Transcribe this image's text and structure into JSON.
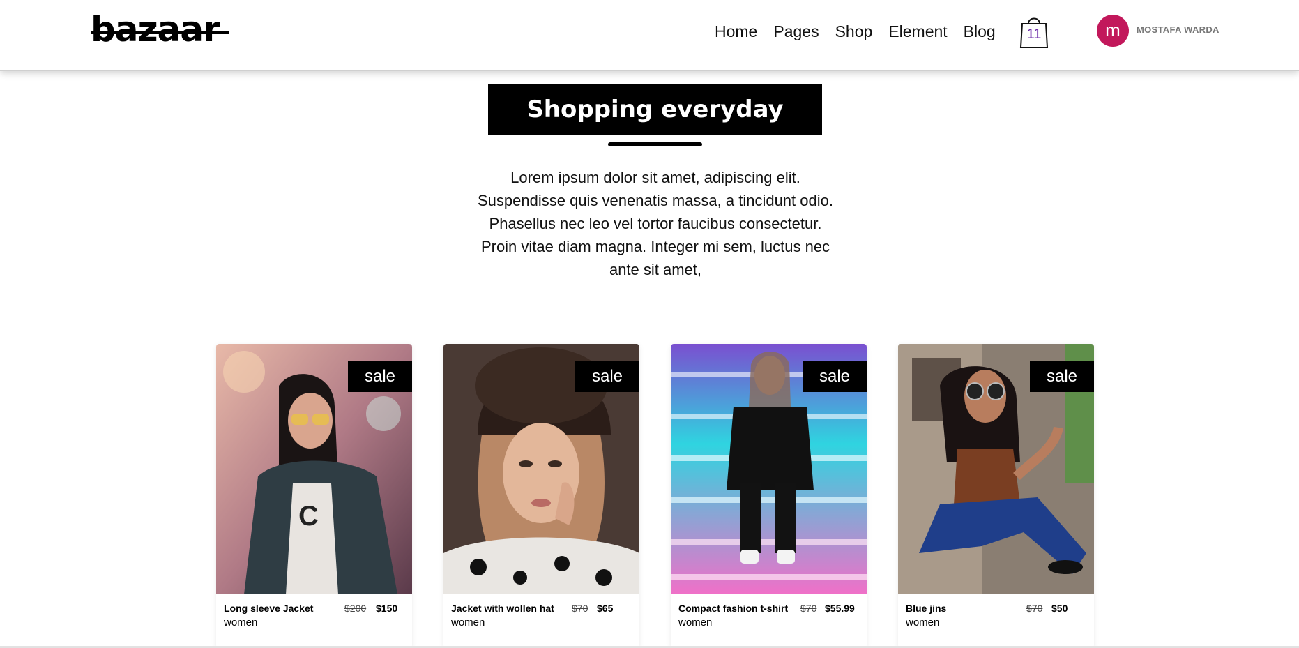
{
  "header": {
    "logo": "bazaar",
    "nav": [
      "Home",
      "Pages",
      "Shop",
      "Element",
      "Blog"
    ],
    "cart_count": "11",
    "avatar_initial": "m",
    "user_name": "MOSTAFA WARDA",
    "avatar_color": "#c2185b"
  },
  "hero": {
    "title": "Shopping everyday",
    "text": "Lorem ipsum dolor sit amet, adipiscing elit. Suspendisse quis venenatis massa, a tincidunt odio. Phasellus nec leo vel tortor faucibus consectetur. Proin vitae diam magna. Integer mi sem, luctus nec ante sit amet,"
  },
  "products": [
    {
      "badge": "sale",
      "name": "Long sleeve Jacket",
      "old_price": "$200",
      "price": "$150",
      "category": "women"
    },
    {
      "badge": "sale",
      "name": "Jacket with wollen hat",
      "old_price": "$70",
      "price": "$65",
      "category": "women"
    },
    {
      "badge": "sale",
      "name": "Compact fashion t-shirt",
      "old_price": "$70",
      "price": "$55.99",
      "category": "women"
    },
    {
      "badge": "sale",
      "name": "Blue jins",
      "old_price": "$70",
      "price": "$50",
      "category": "women"
    }
  ]
}
